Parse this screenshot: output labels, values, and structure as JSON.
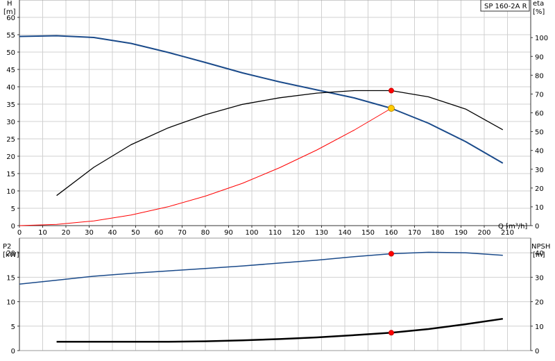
{
  "chart_data": [
    {
      "type": "line",
      "title": "SP 160-2A R",
      "xlabel": "Q [m³/h]",
      "ylabel": "[m]",
      "ylabel_top": "H",
      "y2label": "[%]",
      "y2label_top": "eta",
      "xlim": [
        0,
        220
      ],
      "ylim": [
        0,
        65
      ],
      "y2lim": [
        0,
        120
      ],
      "grid": true,
      "x_ticks": [
        0,
        10,
        20,
        30,
        40,
        50,
        60,
        70,
        80,
        90,
        100,
        110,
        120,
        130,
        140,
        150,
        160,
        170,
        180,
        190,
        200,
        210
      ],
      "y_ticks": [
        0,
        5,
        10,
        15,
        20,
        25,
        30,
        35,
        40,
        45,
        50,
        55,
        60
      ],
      "y2_ticks": [
        0,
        10,
        20,
        30,
        40,
        50,
        60,
        70,
        80,
        90,
        100
      ],
      "series": [
        {
          "key": "head",
          "axis": "left",
          "color": "#1a4a8a",
          "points": [
            [
              0,
              54.5
            ],
            [
              16,
              54.7
            ],
            [
              32,
              54.2
            ],
            [
              48,
              52.5
            ],
            [
              64,
              49.9
            ],
            [
              80,
              47
            ],
            [
              96,
              44
            ],
            [
              112,
              41.4
            ],
            [
              128,
              39.1
            ],
            [
              144,
              36.8
            ],
            [
              160,
              33.8
            ],
            [
              176,
              29.5
            ],
            [
              192,
              24.2
            ],
            [
              208,
              18
            ]
          ]
        },
        {
          "key": "efficiency",
          "axis": "right",
          "color": "#000000",
          "points": [
            [
              16,
              16
            ],
            [
              32,
              31
            ],
            [
              48,
              43
            ],
            [
              64,
              52
            ],
            [
              80,
              59
            ],
            [
              96,
              64.5
            ],
            [
              112,
              68
            ],
            [
              128,
              70.5
            ],
            [
              144,
              71.8
            ],
            [
              160,
              71.8
            ],
            [
              176,
              68.5
            ],
            [
              192,
              62
            ],
            [
              208,
              51
            ]
          ]
        },
        {
          "key": "system-curve",
          "axis": "left",
          "color": "#ff0000",
          "points": [
            [
              0,
              0
            ],
            [
              16,
              0.34
            ],
            [
              32,
              1.36
            ],
            [
              48,
              3.06
            ],
            [
              64,
              5.44
            ],
            [
              80,
              8.5
            ],
            [
              96,
              12.2
            ],
            [
              112,
              16.7
            ],
            [
              128,
              21.8
            ],
            [
              144,
              27.5
            ],
            [
              160,
              33.8
            ]
          ]
        }
      ],
      "markers": [
        {
          "key": "head-duty-point",
          "x": 160,
          "y": 33.8,
          "axis": "left",
          "color": "#ffcc00"
        },
        {
          "key": "efficiency-duty-point",
          "x": 160,
          "y": 71.8,
          "axis": "right",
          "color": "#ff0000"
        }
      ]
    },
    {
      "type": "line",
      "ylabel": "[kW]",
      "ylabel_top": "P2",
      "y2label": "[m]",
      "y2label_top": "NPSH",
      "xlim": [
        0,
        220
      ],
      "ylim": [
        0,
        23
      ],
      "y2lim": [
        0,
        46
      ],
      "grid": true,
      "y_ticks": [
        0,
        5,
        10,
        15,
        20
      ],
      "y2_ticks": [
        0,
        10,
        20,
        30,
        40
      ],
      "series": [
        {
          "key": "power-p2",
          "axis": "left",
          "color": "#1a4a8a",
          "points": [
            [
              0,
              13.6
            ],
            [
              16,
              14.4
            ],
            [
              32,
              15.2
            ],
            [
              48,
              15.8
            ],
            [
              64,
              16.3
            ],
            [
              80,
              16.8
            ],
            [
              96,
              17.3
            ],
            [
              112,
              17.9
            ],
            [
              128,
              18.5
            ],
            [
              144,
              19.2
            ],
            [
              160,
              19.8
            ],
            [
              176,
              20.1
            ],
            [
              192,
              20
            ],
            [
              208,
              19.5
            ]
          ]
        },
        {
          "key": "npsh",
          "axis": "right",
          "color": "#000000",
          "points": [
            [
              16,
              3.6
            ],
            [
              32,
              3.6
            ],
            [
              48,
              3.6
            ],
            [
              64,
              3.6
            ],
            [
              80,
              3.8
            ],
            [
              96,
              4.2
            ],
            [
              112,
              4.7
            ],
            [
              128,
              5.4
            ],
            [
              144,
              6.3
            ],
            [
              160,
              7.3
            ],
            [
              176,
              8.8
            ],
            [
              192,
              10.8
            ],
            [
              208,
              13
            ]
          ]
        }
      ],
      "markers": [
        {
          "key": "power-duty-point",
          "x": 160,
          "y": 19.8,
          "axis": "left",
          "color": "#ff0000"
        },
        {
          "key": "npsh-duty-point",
          "x": 160,
          "y": 7.3,
          "axis": "right",
          "color": "#ff0000"
        }
      ]
    }
  ]
}
